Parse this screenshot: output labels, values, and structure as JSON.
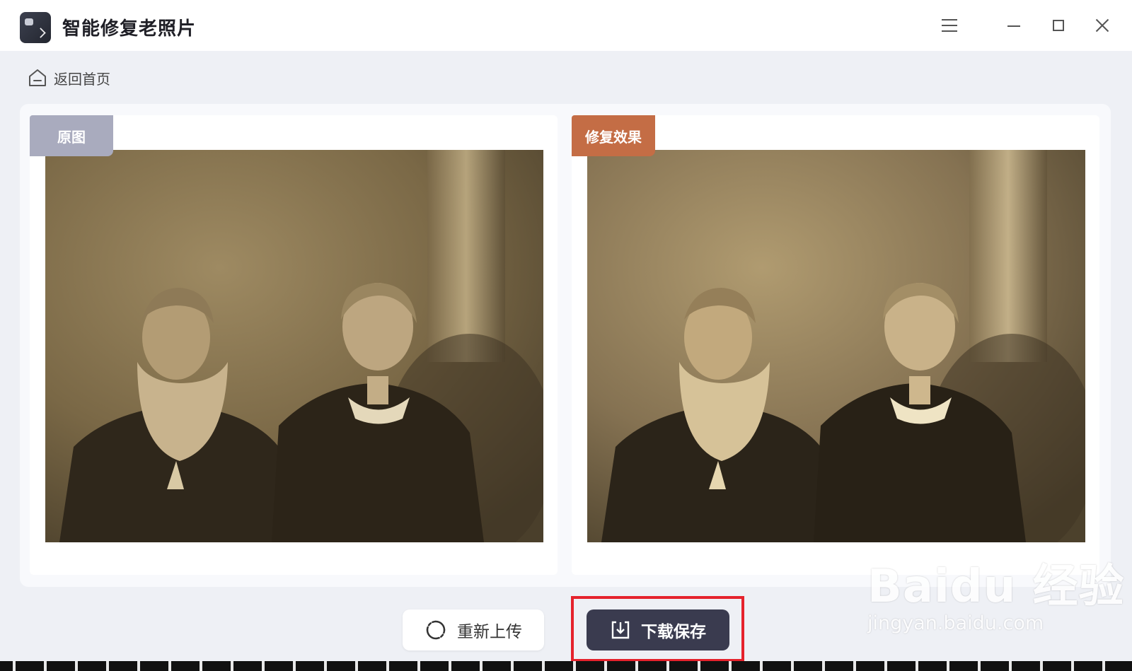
{
  "app": {
    "title": "智能修复老照片"
  },
  "nav": {
    "back_label": "返回首页"
  },
  "panels": {
    "original_label": "原图",
    "result_label": "修复效果"
  },
  "actions": {
    "reupload_label": "重新上传",
    "download_label": "下载保存"
  },
  "watermark": {
    "main": "Baidu 经验",
    "sub": "jingyan.baidu.com"
  },
  "colors": {
    "accent_orange": "#c46d45",
    "label_gray": "#a9abbe",
    "download_bg": "#3a3b4f",
    "highlight_red": "#e5222c"
  }
}
